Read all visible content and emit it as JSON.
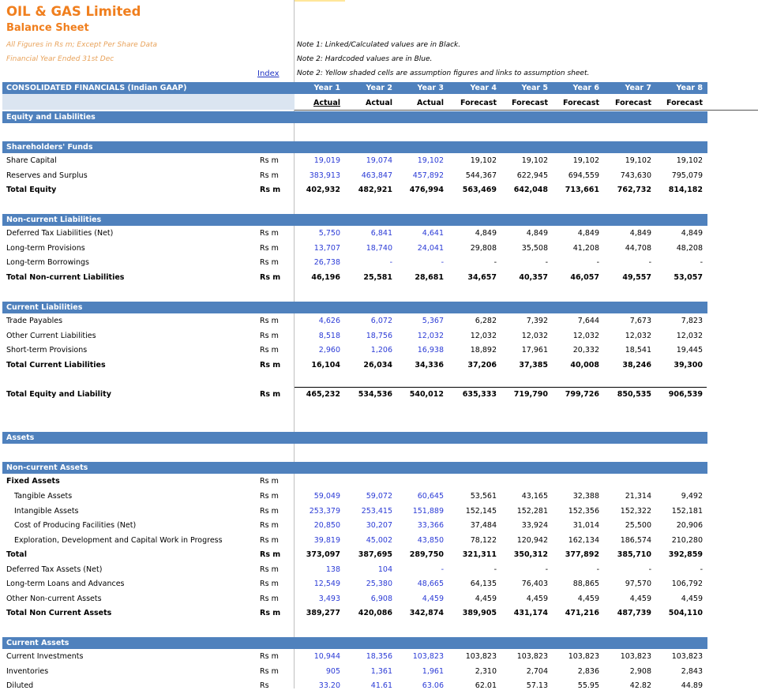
{
  "header": {
    "company": "OIL & GAS Limited",
    "sheet": "Balance Sheet",
    "figures_note": "All Figures in Rs m; Except Per Share Data",
    "fy_note": "Financial Year Ended 31st Dec",
    "index_link": "Index",
    "notes": [
      "Note 1: Linked/Calculated values are in Black.",
      "Note 2: Hardcoded values are in Blue.",
      "Note 2: Yellow shaded cells are assumption figures and links to assumption sheet."
    ]
  },
  "table_header": {
    "label": "CONSOLIDATED FINANCIALS (Indian GAAP)",
    "years": [
      "Year 1",
      "Year 2",
      "Year 3",
      "Year 4",
      "Year 5",
      "Year 6",
      "Year 7",
      "Year 8"
    ],
    "types": [
      "Actual",
      "Actual",
      "Actual",
      "Forecast",
      "Forecast",
      "Forecast",
      "Forecast",
      "Forecast"
    ]
  },
  "sections": {
    "equity_liabilities": "Equity and Liabilities",
    "shareholders_funds": "Shareholders' Funds",
    "non_current_liabilities": "Non-current Liabilities",
    "current_liabilities": "Current Liabilities",
    "assets": "Assets",
    "non_current_assets": "Non-current Assets",
    "current_assets": "Current Assets"
  },
  "rows": {
    "share_capital": {
      "label": "Share Capital",
      "unit": "Rs m",
      "values": [
        "19,019",
        "19,074",
        "19,102",
        "19,102",
        "19,102",
        "19,102",
        "19,102",
        "19,102"
      ]
    },
    "reserves": {
      "label": "Reserves and Surplus",
      "unit": "Rs m",
      "values": [
        "383,913",
        "463,847",
        "457,892",
        "544,367",
        "622,945",
        "694,559",
        "743,630",
        "795,079"
      ]
    },
    "total_equity": {
      "label": "Total Equity",
      "unit": "Rs m",
      "values": [
        "402,932",
        "482,921",
        "476,994",
        "563,469",
        "642,048",
        "713,661",
        "762,732",
        "814,182"
      ]
    },
    "deferred_tax_liab": {
      "label": "Deferred Tax Liabilities (Net)",
      "unit": "Rs m",
      "values": [
        "5,750",
        "6,841",
        "4,641",
        "4,849",
        "4,849",
        "4,849",
        "4,849",
        "4,849"
      ]
    },
    "lt_provisions": {
      "label": "Long-term Provisions",
      "unit": "Rs m",
      "values": [
        "13,707",
        "18,740",
        "24,041",
        "29,808",
        "35,508",
        "41,208",
        "44,708",
        "48,208"
      ]
    },
    "lt_borrowings": {
      "label": "Long-term Borrowings",
      "unit": "Rs m",
      "values": [
        "26,738",
        "-",
        "-",
        "-",
        "-",
        "-",
        "-",
        "-"
      ]
    },
    "total_ncl": {
      "label": "Total Non-current Liabilities",
      "unit": "Rs m",
      "values": [
        "46,196",
        "25,581",
        "28,681",
        "34,657",
        "40,357",
        "46,057",
        "49,557",
        "53,057"
      ]
    },
    "trade_payables": {
      "label": "Trade Payables",
      "unit": "Rs m",
      "values": [
        "4,626",
        "6,072",
        "5,367",
        "6,282",
        "7,392",
        "7,644",
        "7,673",
        "7,823"
      ]
    },
    "other_cl": {
      "label": "Other Current Liabilities",
      "unit": "Rs m",
      "values": [
        "8,518",
        "18,756",
        "12,032",
        "12,032",
        "12,032",
        "12,032",
        "12,032",
        "12,032"
      ]
    },
    "st_provisions": {
      "label": "Short-term Provisions",
      "unit": "Rs m",
      "values": [
        "2,960",
        "1,206",
        "16,938",
        "18,892",
        "17,961",
        "20,332",
        "18,541",
        "19,445"
      ]
    },
    "total_cl": {
      "label": "Total Current Liabilities",
      "unit": "Rs m",
      "values": [
        "16,104",
        "26,034",
        "34,336",
        "37,206",
        "37,385",
        "40,008",
        "38,246",
        "39,300"
      ]
    },
    "total_eq_liab": {
      "label": "Total Equity and Liability",
      "unit": "Rs m",
      "values": [
        "465,232",
        "534,536",
        "540,012",
        "635,333",
        "719,790",
        "799,726",
        "850,535",
        "906,539"
      ]
    },
    "fixed_assets": {
      "label": "Fixed Assets",
      "unit": "Rs m",
      "values": [
        "",
        "",
        "",
        "",
        "",
        "",
        "",
        ""
      ]
    },
    "tangible": {
      "label": "Tangible Assets",
      "unit": "Rs m",
      "values": [
        "59,049",
        "59,072",
        "60,645",
        "53,561",
        "43,165",
        "32,388",
        "21,314",
        "9,492"
      ]
    },
    "intangible": {
      "label": "Intangible Assets",
      "unit": "Rs m",
      "values": [
        "253,379",
        "253,415",
        "151,889",
        "152,145",
        "152,281",
        "152,356",
        "152,322",
        "152,181"
      ]
    },
    "cost_facilities": {
      "label": "Cost of Producing Facilities (Net)",
      "unit": "Rs m",
      "values": [
        "20,850",
        "30,207",
        "33,366",
        "37,484",
        "33,924",
        "31,014",
        "25,500",
        "20,906"
      ]
    },
    "exploration": {
      "label": "Exploration, Development and Capital Work in Progress",
      "unit": "Rs m",
      "values": [
        "39,819",
        "45,002",
        "43,850",
        "78,122",
        "120,942",
        "162,134",
        "186,574",
        "210,280"
      ]
    },
    "total_fixed": {
      "label": "Total",
      "unit": "Rs m",
      "values": [
        "373,097",
        "387,695",
        "289,750",
        "321,311",
        "350,312",
        "377,892",
        "385,710",
        "392,859"
      ]
    },
    "deferred_tax_assets": {
      "label": "Deferred Tax Assets (Net)",
      "unit": "Rs m",
      "values": [
        "138",
        "104",
        "-",
        "-",
        "-",
        "-",
        "-",
        "-"
      ]
    },
    "lt_loans": {
      "label": "Long-term Loans and Advances",
      "unit": "Rs m",
      "values": [
        "12,549",
        "25,380",
        "48,665",
        "64,135",
        "76,403",
        "88,865",
        "97,570",
        "106,792"
      ]
    },
    "other_nca": {
      "label": "Other Non-current Assets",
      "unit": "Rs m",
      "values": [
        "3,493",
        "6,908",
        "4,459",
        "4,459",
        "4,459",
        "4,459",
        "4,459",
        "4,459"
      ]
    },
    "total_nca": {
      "label": "Total Non Current Assets",
      "unit": "Rs m",
      "values": [
        "389,277",
        "420,086",
        "342,874",
        "389,905",
        "431,174",
        "471,216",
        "487,739",
        "504,110"
      ]
    },
    "current_investments": {
      "label": "Current Investments",
      "unit": "Rs m",
      "values": [
        "10,944",
        "18,356",
        "103,823",
        "103,823",
        "103,823",
        "103,823",
        "103,823",
        "103,823"
      ]
    },
    "inventories": {
      "label": "Inventories",
      "unit": "Rs m",
      "values": [
        "905",
        "1,361",
        "1,961",
        "2,310",
        "2,704",
        "2,836",
        "2,908",
        "2,843"
      ]
    },
    "diluted": {
      "label": "Diluted",
      "unit": "Rs",
      "values": [
        "33.20",
        "41.61",
        "63.06",
        "62.01",
        "57.13",
        "55.95",
        "42.82",
        "44.89"
      ]
    }
  }
}
